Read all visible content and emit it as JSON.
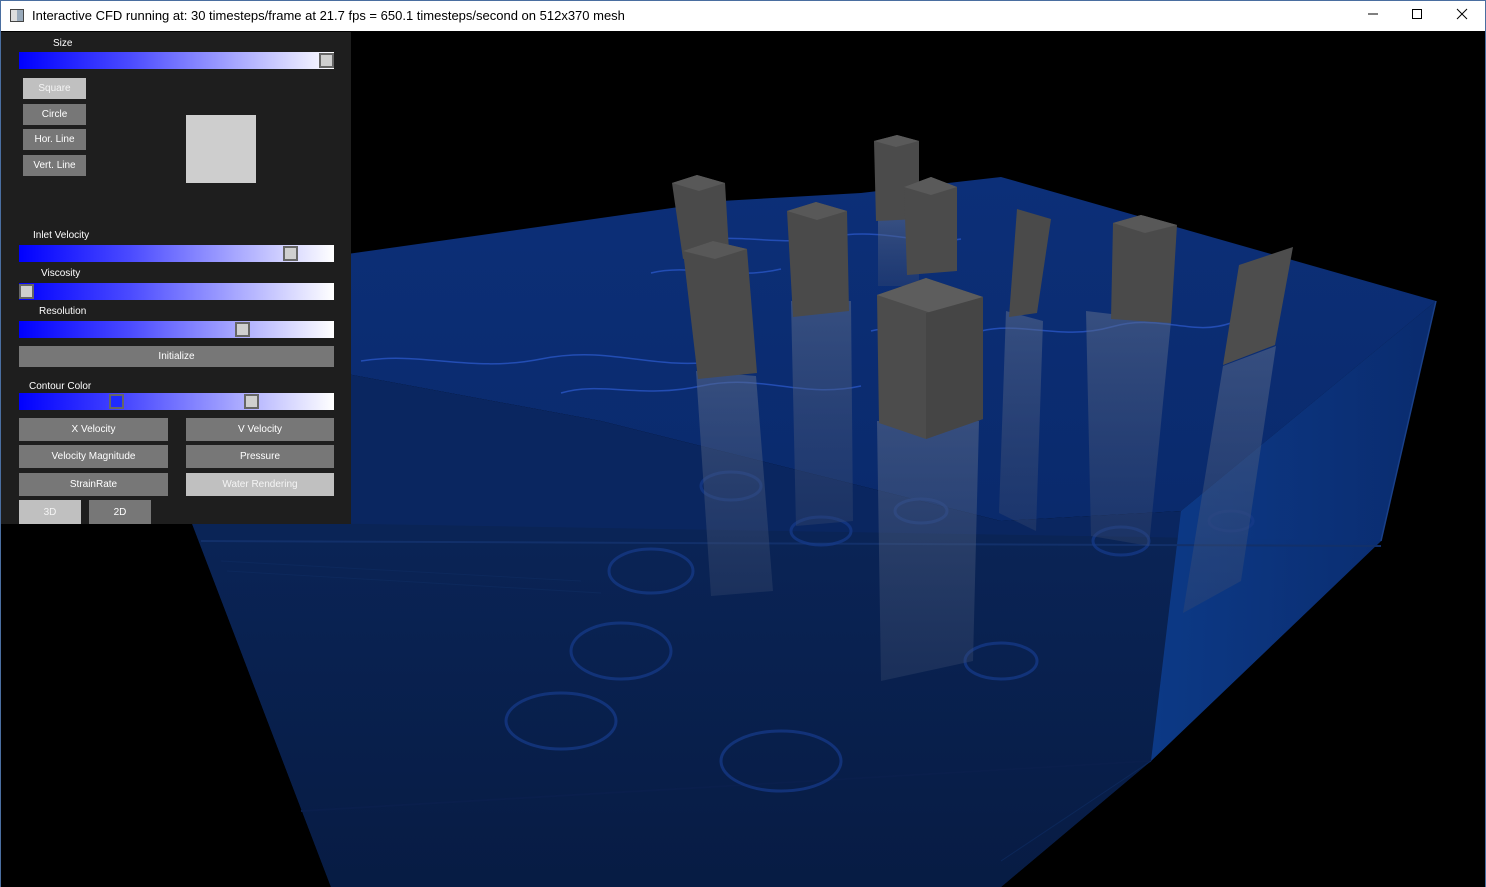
{
  "window": {
    "title": "Interactive CFD running at: 30 timesteps/frame at 21.7 fps = 650.1 timesteps/second on 512x370 mesh",
    "minimize_icon": "minimize-icon",
    "maximize_icon": "maximize-icon",
    "close_icon": "close-icon"
  },
  "panel": {
    "size_label": "Size",
    "size_value": 1.0,
    "shape_buttons": [
      "Square",
      "Circle",
      "Hor. Line",
      "Vert. Line"
    ],
    "selected_shape": "Square",
    "inlet_velocity_label": "Inlet Velocity",
    "inlet_velocity_value": 0.88,
    "viscosity_label": "Viscosity",
    "viscosity_value": 0.0,
    "resolution_label": "Resolution",
    "resolution_value": 0.72,
    "initialize_label": "Initialize",
    "contour_color_label": "Contour Color",
    "contour_color_low": 0.3,
    "contour_color_high": 0.75,
    "x_velocity_label": "X Velocity",
    "v_velocity_label": "V Velocity",
    "velocity_magnitude_label": "Velocity Magnitude",
    "pressure_label": "Pressure",
    "strainrate_label": "StrainRate",
    "water_rendering_label": "Water Rendering",
    "view_3d_label": "3D",
    "view_2d_label": "2D"
  },
  "colors": {
    "water": "#0b2a6e",
    "obstacle": "#4a4a4a",
    "slider_start": "#0000ff",
    "slider_end": "#ffffff",
    "panel_bg": "#1e1e1e"
  }
}
